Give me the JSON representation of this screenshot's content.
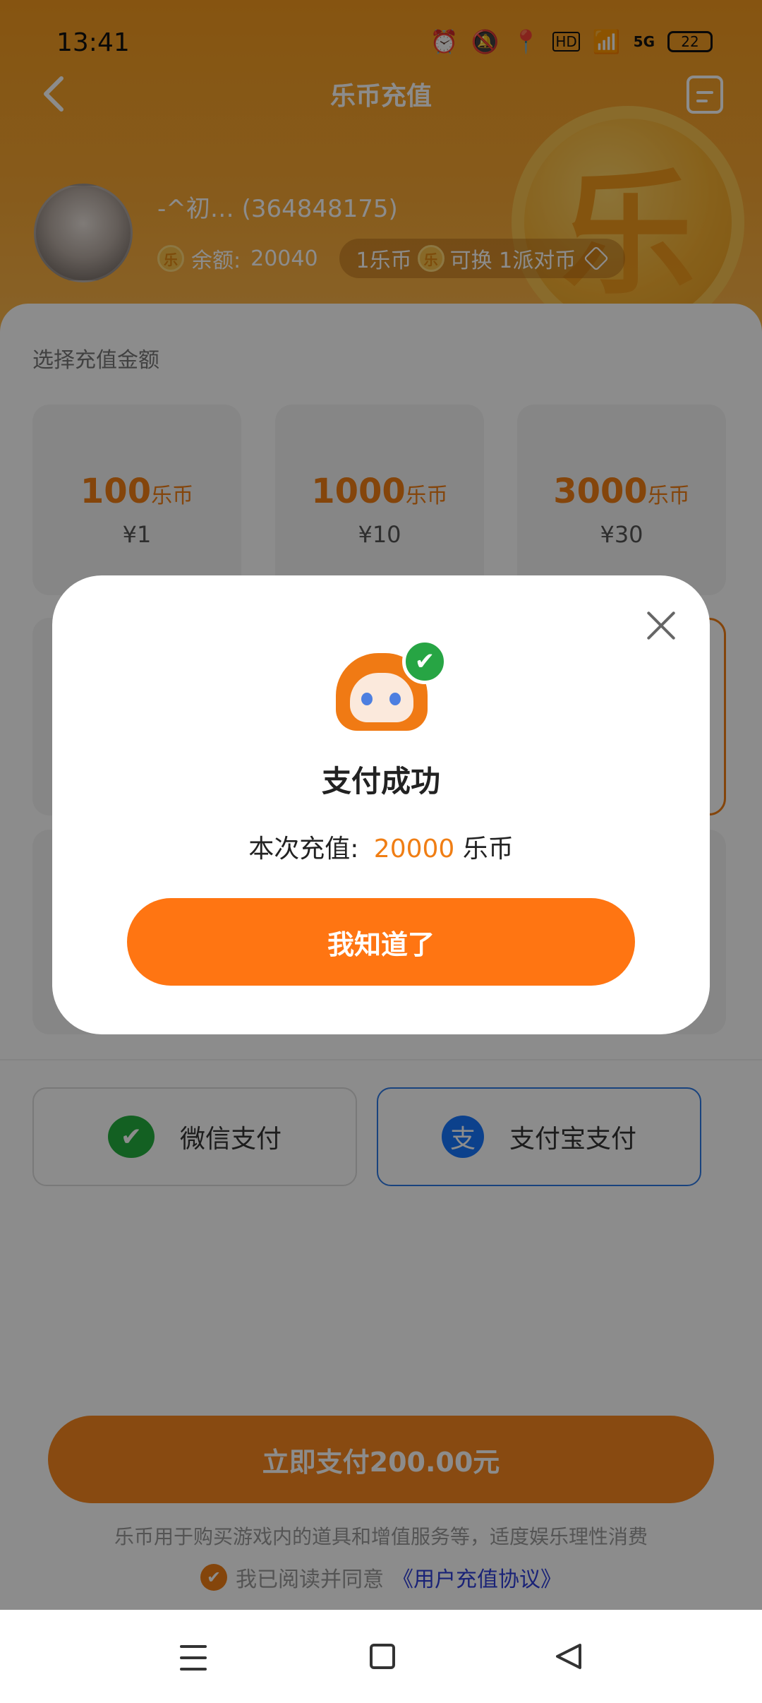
{
  "status_bar": {
    "time": "13:41",
    "hd_label": "HD",
    "network_label": "5G",
    "battery": "22"
  },
  "nav": {
    "title": "乐币充值"
  },
  "user": {
    "name": "-^初…",
    "id": "(364848175)",
    "balance_label": "余额:",
    "balance_value": "20040",
    "exchange_text_1": "1乐币",
    "exchange_text_2": "可换 1派对币",
    "coin_glyph": "乐"
  },
  "recharge": {
    "section_label": "选择充值金额",
    "options": [
      {
        "amount": "100",
        "unit": "乐币",
        "price": "¥1"
      },
      {
        "amount": "1000",
        "unit": "乐币",
        "price": "¥10"
      },
      {
        "amount": "3000",
        "unit": "乐币",
        "price": "¥30"
      }
    ]
  },
  "payment": {
    "wechat_label": "微信支付",
    "alipay_label": "支付宝支付",
    "alipay_glyph": "支",
    "selected": "alipay"
  },
  "footer": {
    "pay_button": "立即支付200.00元",
    "disclaimer": "乐币用于购买游戏内的道具和增值服务等，适度娱乐理性消费",
    "agree_text": "我已阅读并同意",
    "agree_link": "《用户充值协议》"
  },
  "modal": {
    "title": "支付成功",
    "message_prefix": "本次充值:",
    "amount": "20000",
    "unit": "乐币",
    "button": "我知道了"
  },
  "colors": {
    "accent": "#f07e14",
    "button_orange": "#ff7512",
    "alipay_blue": "#1677ff",
    "wechat_green": "#23b03e"
  }
}
